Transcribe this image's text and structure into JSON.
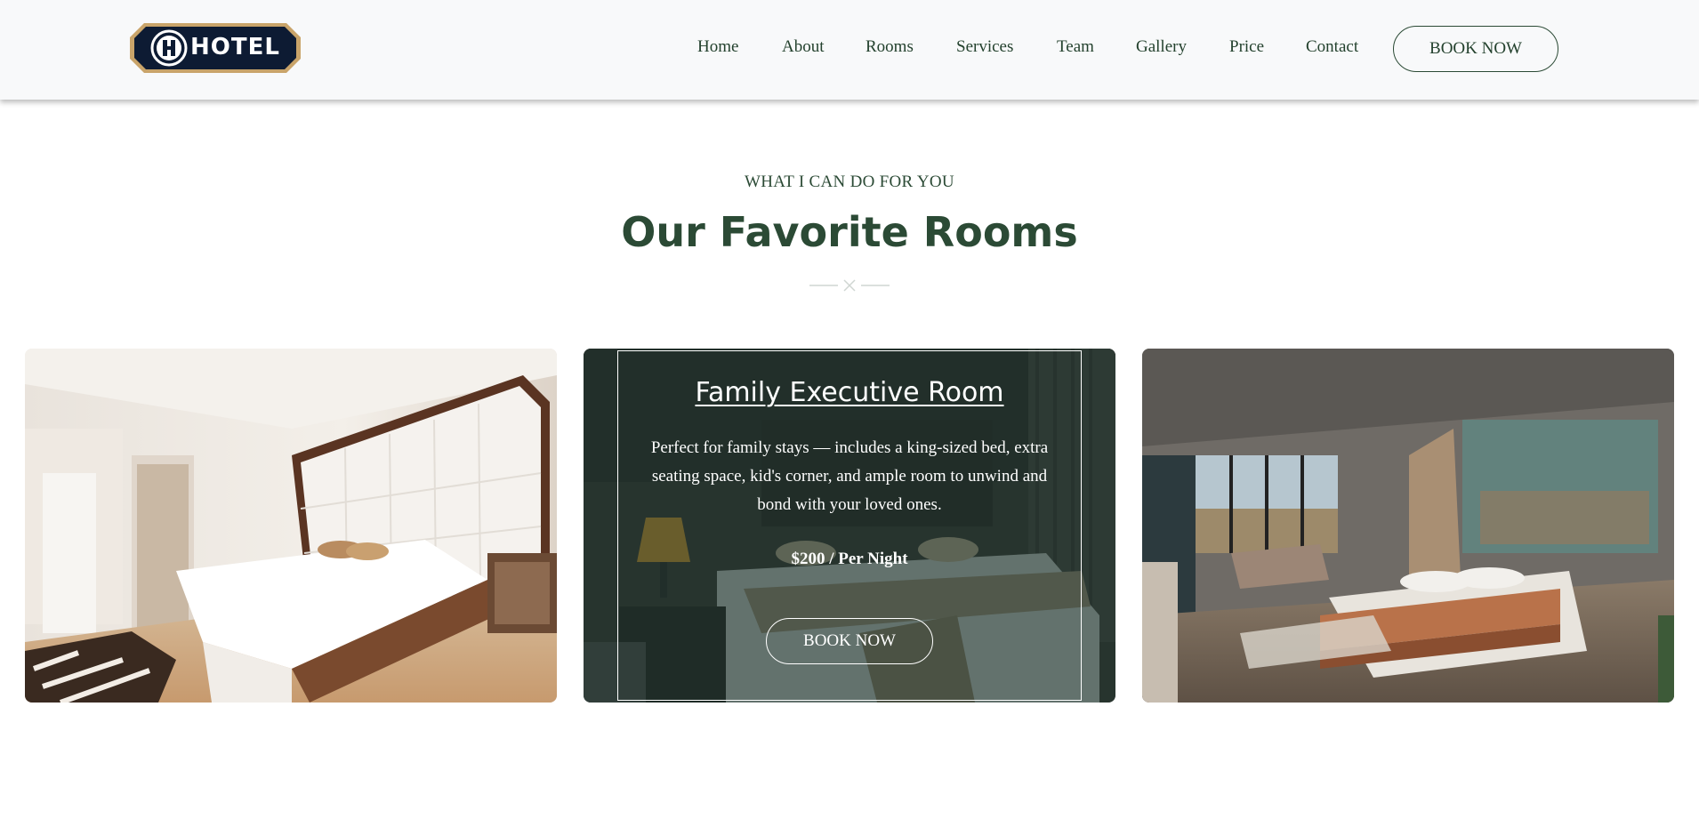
{
  "header": {
    "logo_text": "HOTEL",
    "nav": [
      "Home",
      "About",
      "Rooms",
      "Services",
      "Team",
      "Gallery",
      "Price",
      "Contact"
    ],
    "book_label": "BOOK NOW"
  },
  "section": {
    "kicker": "WHAT I CAN DO FOR YOU",
    "title": "Our Favorite Rooms"
  },
  "featured_room": {
    "title": "Family Executive Room",
    "description": "Perfect for family stays — includes a king-sized bed, extra seating space, kid's corner, and ample room to unwind and bond with your loved ones.",
    "price": "$200 / Per Night",
    "button": "BOOK NOW"
  },
  "colors": {
    "brand_green": "#2b4a35",
    "header_bg": "#f8f9fa",
    "logo_navy": "#0d1b33",
    "logo_gold": "#c9a46a",
    "overlay": "#1c302a"
  }
}
